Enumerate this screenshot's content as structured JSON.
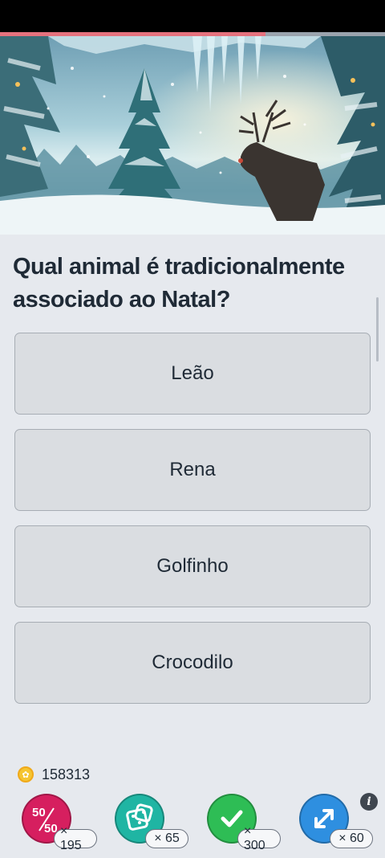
{
  "quiz": {
    "progress_fraction": 0.69,
    "question": "Qual animal é tradicionalmente associado ao Natal?",
    "answers": [
      {
        "label": "Leão"
      },
      {
        "label": "Rena"
      },
      {
        "label": "Golfinho"
      },
      {
        "label": "Crocodilo"
      }
    ]
  },
  "wallet": {
    "coins": "158313"
  },
  "powerups": [
    {
      "icon": "fifty-fifty-icon",
      "label": "50/50",
      "count": "× 195",
      "color": "#d61f5f"
    },
    {
      "icon": "dice-icon",
      "count": "× 65",
      "color": "#1fb5a3"
    },
    {
      "icon": "checkmark-icon",
      "count": "× 300",
      "color": "#2ebd55"
    },
    {
      "icon": "swap-arrows-icon",
      "count": "× 60",
      "color": "#2e8fe0"
    }
  ],
  "info": {
    "icon": "info-icon",
    "glyph": "i"
  }
}
